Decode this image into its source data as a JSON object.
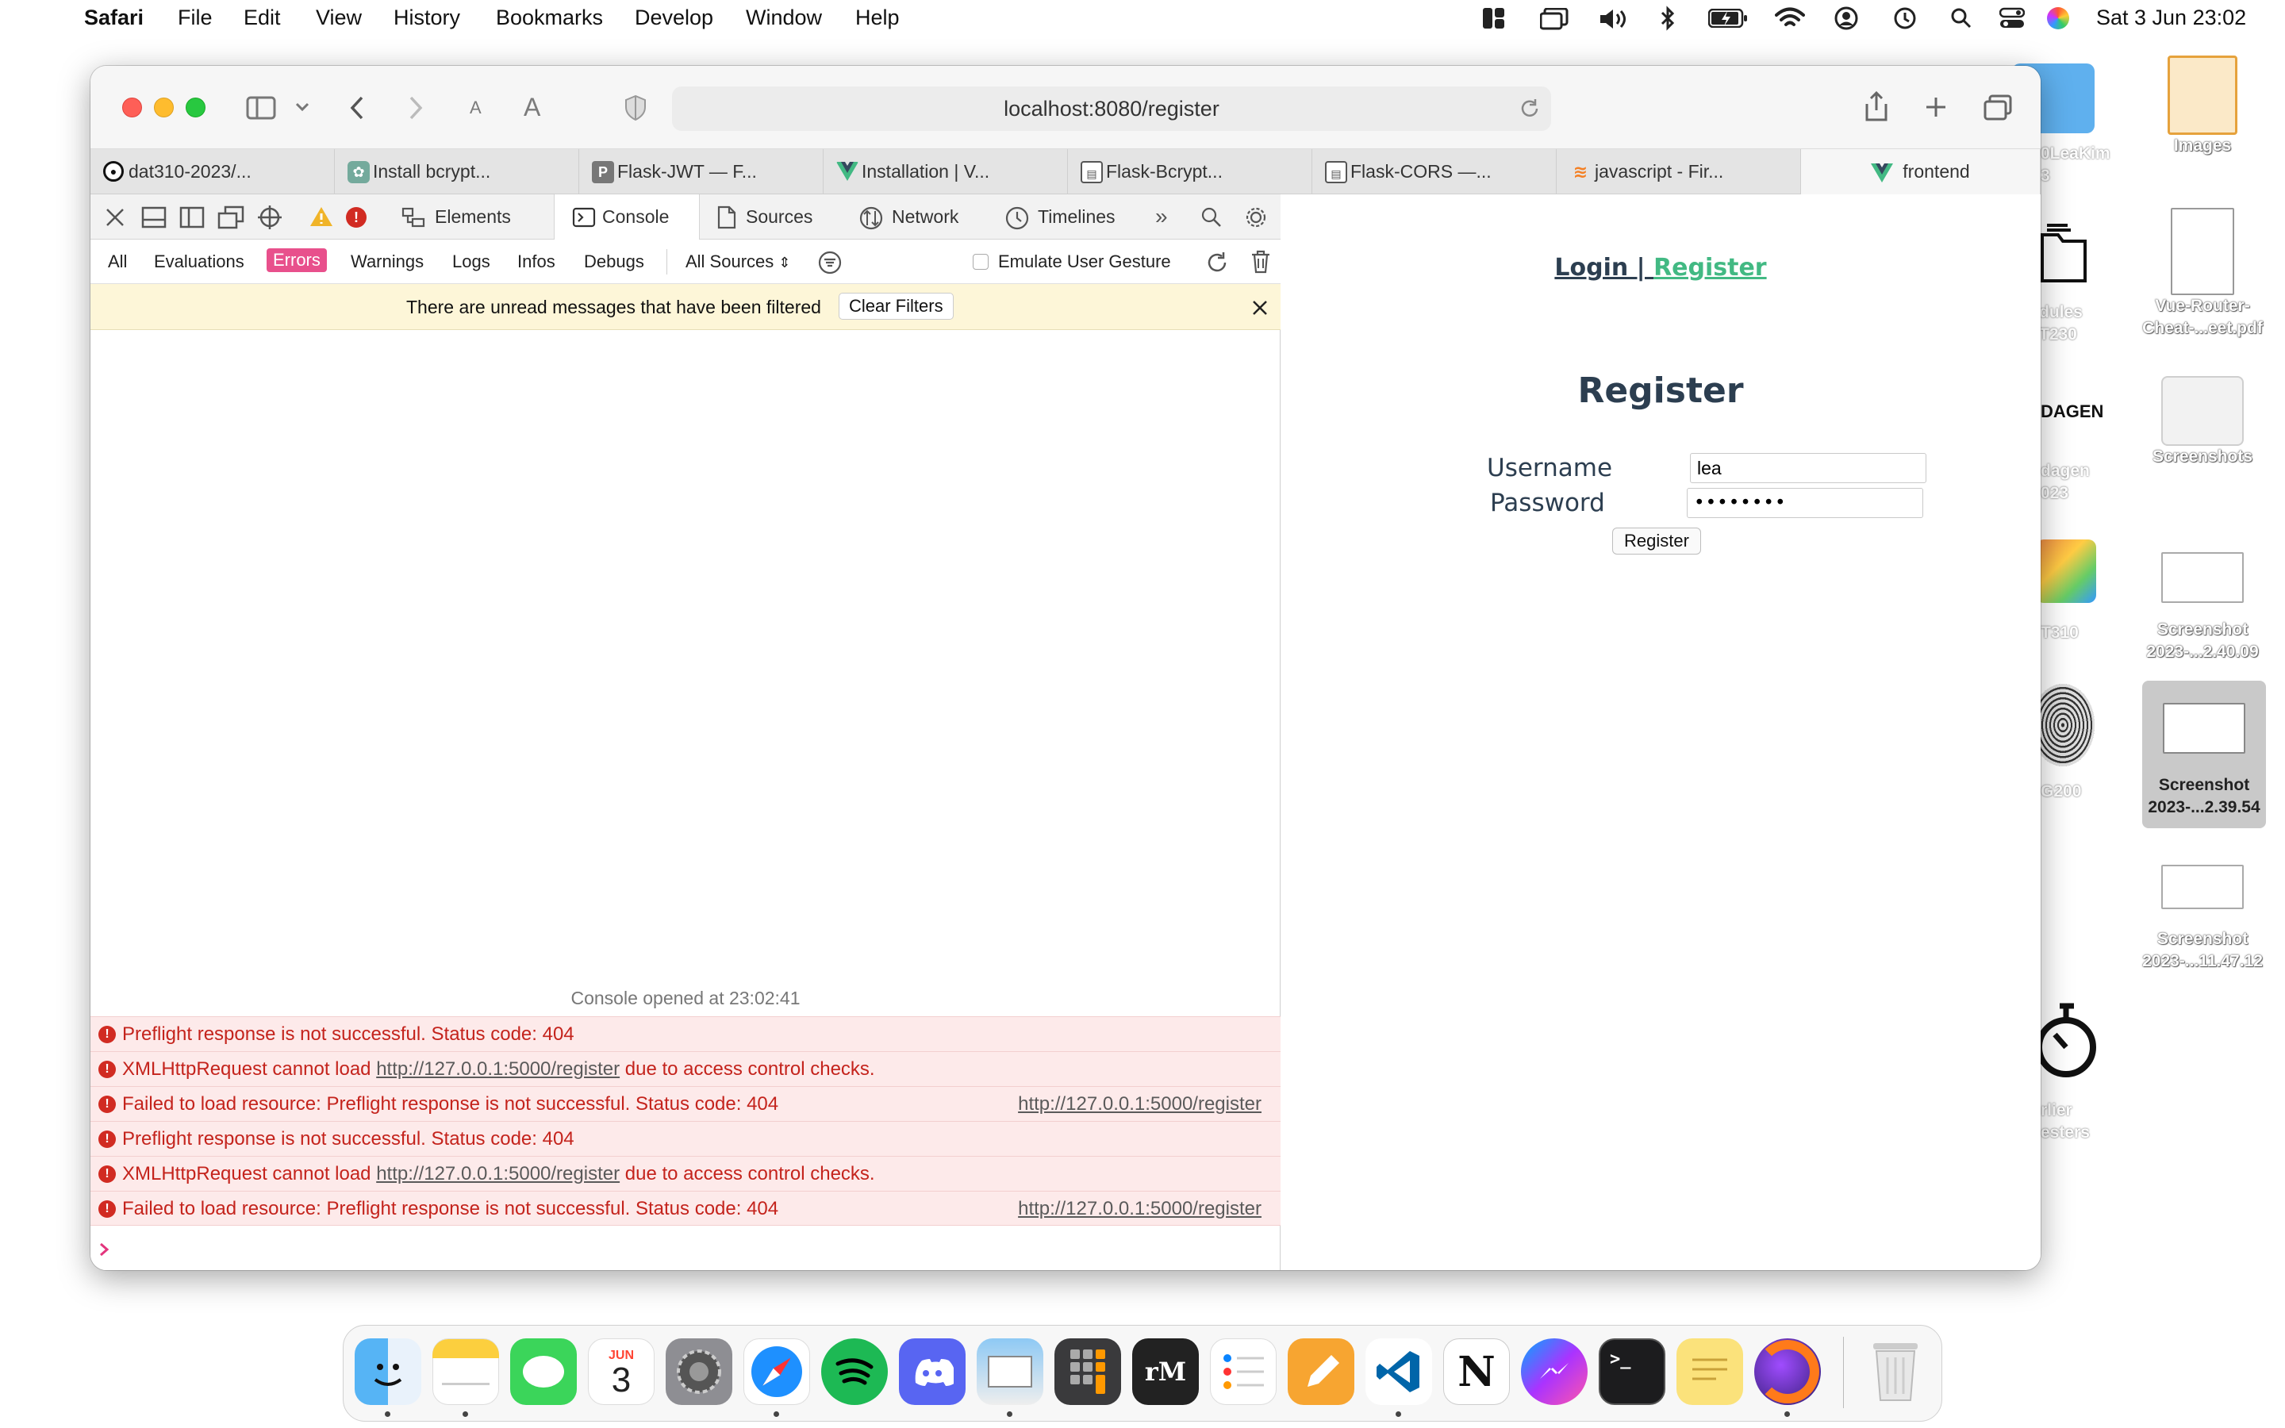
{
  "menubar": {
    "app_name": "Safari",
    "menus": [
      "File",
      "Edit",
      "View",
      "History",
      "Bookmarks",
      "Develop",
      "Window",
      "Help"
    ],
    "datetime": "Sat 3 Jun  23:02"
  },
  "desktop": {
    "icons": [
      {
        "label": "Images"
      },
      {
        "label": "Vue-Router-Cheat-...eet.pdf"
      },
      {
        "label": "Screenshots"
      },
      {
        "label": "Screenshot 2023-...2.40.09"
      },
      {
        "label": "Screenshot 2023-...2.39.54"
      },
      {
        "label": "Screenshot 2023-...11.47.12"
      }
    ],
    "partial_labels": [
      {
        "label": "0LeaKim\n3"
      },
      {
        "label": "dules\nT230"
      },
      {
        "label": "dagen\n023"
      },
      {
        "label": "T310"
      },
      {
        "label": "G200"
      },
      {
        "label": "rlier\nesters"
      }
    ],
    "dagen_text": "DAGEN"
  },
  "browser": {
    "url": "localhost:8080/register",
    "tabs": [
      {
        "label": "dat310-2023/...",
        "icon": "github-icon"
      },
      {
        "label": "Install bcrypt...",
        "icon": "openai-icon"
      },
      {
        "label": "Flask-JWT — F...",
        "icon": "p-icon"
      },
      {
        "label": "Installation | V...",
        "icon": "vue-icon"
      },
      {
        "label": "Flask-Bcrypt...",
        "icon": "doc-icon"
      },
      {
        "label": "Flask-CORS —...",
        "icon": "doc-icon"
      },
      {
        "label": "javascript - Fir...",
        "icon": "stackoverflow-icon"
      },
      {
        "label": "frontend",
        "icon": "vue-icon"
      }
    ]
  },
  "devtools": {
    "tabs": [
      "Elements",
      "Console",
      "Sources",
      "Network",
      "Timelines"
    ],
    "filters": [
      "All",
      "Evaluations",
      "Errors",
      "Warnings",
      "Logs",
      "Infos",
      "Debugs"
    ],
    "sources_select": "All Sources",
    "emulate_label": "Emulate User Gesture",
    "filtered_msg": "There are unread messages that have been filtered",
    "clear_filters": "Clear Filters",
    "opened_at": "Console opened at 23:02:41",
    "messages": [
      {
        "pre": "Preflight response is not successful. Status code: 404",
        "link": "",
        "post": "",
        "source": ""
      },
      {
        "pre": "XMLHttpRequest cannot load ",
        "link": "http://127.0.0.1:5000/register",
        "post": " due to access control checks.",
        "source": ""
      },
      {
        "pre": "Failed to load resource: Preflight response is not successful. Status code: 404",
        "link": "",
        "post": "",
        "source": "http://127.0.0.1:5000/register"
      },
      {
        "pre": "Preflight response is not successful. Status code: 404",
        "link": "",
        "post": "",
        "source": ""
      },
      {
        "pre": "XMLHttpRequest cannot load ",
        "link": "http://127.0.0.1:5000/register",
        "post": " due to access control checks.",
        "source": ""
      },
      {
        "pre": "Failed to load resource: Preflight response is not successful. Status code: 404",
        "link": "",
        "post": "",
        "source": "http://127.0.0.1:5000/register"
      }
    ]
  },
  "page": {
    "nav_login": "Login | ",
    "nav_register": "Register",
    "title": "Register",
    "username_label": "Username",
    "username_value": "lea",
    "password_label": "Password",
    "password_value": "••••••••",
    "submit_label": "Register"
  },
  "dock": {
    "apps": [
      "finder",
      "notes",
      "messages",
      "calendar",
      "system-settings",
      "safari",
      "spotify",
      "discord",
      "preview",
      "calculator",
      "remarkable",
      "reminders",
      "pages",
      "vscode",
      "notion",
      "messenger",
      "terminal",
      "stickies",
      "firefox",
      "trash"
    ],
    "calendar_month": "JUN",
    "calendar_day": "3",
    "remarkable_text": "rM"
  },
  "colors": {
    "error_red": "#d12b22",
    "errors_pill": "#e8508c",
    "vue_green": "#42b983",
    "vue_dark": "#2c3e50"
  }
}
